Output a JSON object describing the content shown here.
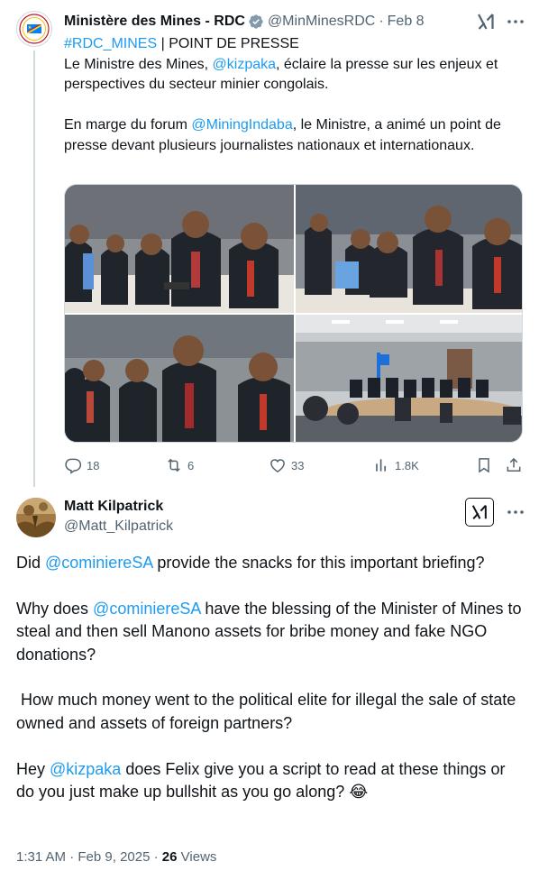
{
  "parent_tweet": {
    "author_name": "Ministère des Mines - RDC",
    "handle": "@MinMinesRDC",
    "separator": "·",
    "date": "Feb 8",
    "line1_tag": "#RDC_MINES",
    "line1_rest": " | POINT DE PRESSE",
    "p1_pre": "Le Ministre des Mines, ",
    "p1_mention": "@kizpaka",
    "p1_post": ", éclaire la presse sur les enjeux et perspectives du secteur minier congolais.",
    "p2_pre": "En marge du forum ",
    "p2_mention": "@MiningIndaba",
    "p2_post": ", le Ministre, a animé un point de presse devant plusieurs journalistes nationaux et internationaux.",
    "stats": {
      "replies": "18",
      "reposts": "6",
      "likes": "33",
      "views": "1.8K"
    }
  },
  "reply": {
    "author_name": "Matt Kilpatrick",
    "handle": "@Matt_Kilpatrick",
    "q1_pre": "Did ",
    "q1_mention": "@cominiereSA",
    "q1_post": " provide the snacks for this important briefing?",
    "q2_pre": "Why does ",
    "q2_mention": "@cominiereSA",
    "q2_post": " have the blessing of the Minister of Mines to steal and then sell Manono assets for bribe money and fake NGO donations?",
    "q3": " How much money went to the political elite for illegal the sale of state owned and assets of foreign partners?",
    "q4_pre": "Hey ",
    "q4_mention": "@kizpaka",
    "q4_post": " does Felix give you a script to read at these things or do you just make up bullshit as you go along? 😂",
    "time": "1:31 AM",
    "separator": "·",
    "date": "Feb 9, 2025",
    "separator2": "·",
    "views_count": "26",
    "views_label": "Views"
  },
  "icons": {
    "verified": "verified-badge-icon",
    "grok": "grok-icon",
    "more": "more-icon",
    "reply": "reply-icon",
    "repost": "repost-icon",
    "like": "like-icon",
    "views": "views-icon",
    "bookmark": "bookmark-icon",
    "share": "share-icon"
  },
  "colors": {
    "link": "#1d9bf0",
    "secondary_text": "#536471",
    "primary_text": "#0f1419",
    "verified": "#829aab"
  }
}
